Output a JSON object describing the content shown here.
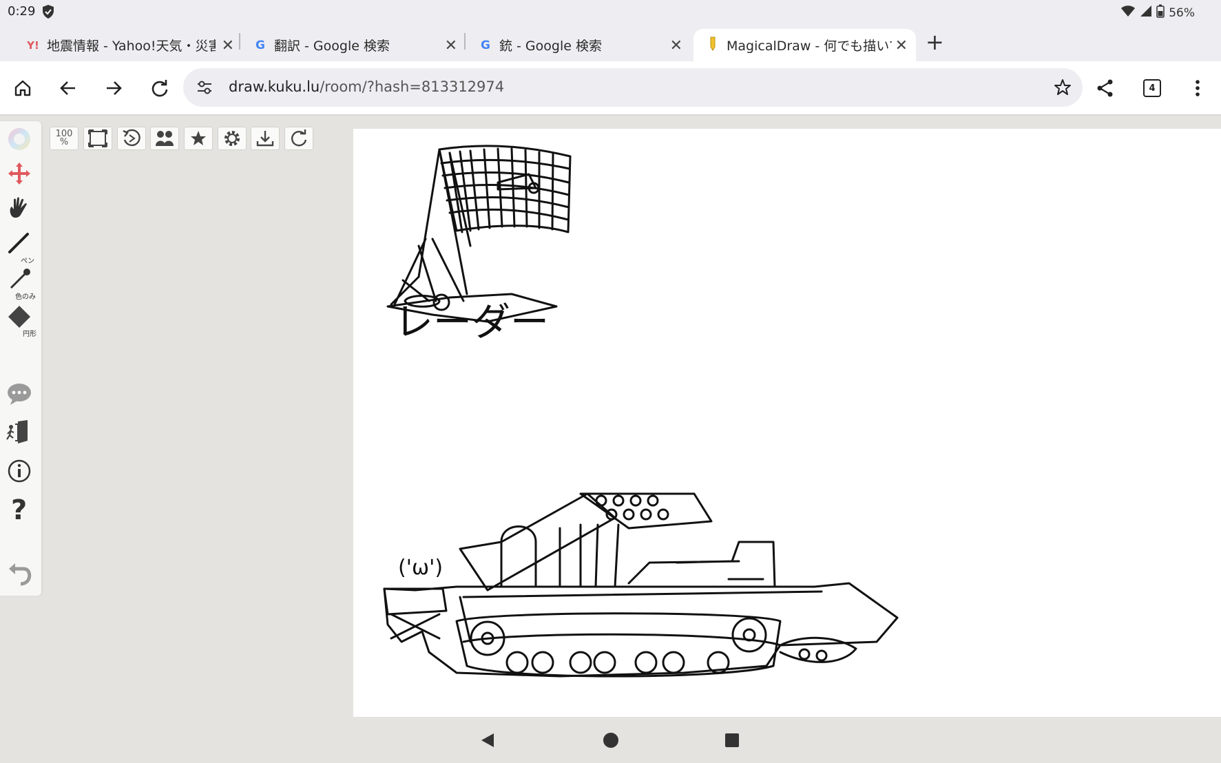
{
  "status": {
    "time": "0:29",
    "battery": "56%"
  },
  "tabs": [
    {
      "favicon": "Y!",
      "title": "地震情報 - Yahoo!天気・災害"
    },
    {
      "favicon": "G",
      "title": "翻訳 - Google 検索"
    },
    {
      "favicon": "G",
      "title": "銃 - Google 検索"
    },
    {
      "favicon": "pencil-favicon",
      "title": "MagicalDraw - 何でも描いて"
    }
  ],
  "toolbar": {
    "url_host": "draw.kuku.lu",
    "url_path": "/room/?hash=813312974",
    "tab_count": "4"
  },
  "left_tools": {
    "pen_label": "ペン",
    "eyedropper_label": "色のみ",
    "eraser_label": "円形"
  },
  "top_tools": {
    "zoom_top": "100",
    "zoom_bottom": "%"
  },
  "drawing": {
    "radar_caption": "レーダー",
    "face_emoticon": "('ω')"
  },
  "colors": {
    "accent_red": "#e0585e",
    "tab_active": "#ffffff",
    "chrome_bg": "#eeedf1"
  }
}
